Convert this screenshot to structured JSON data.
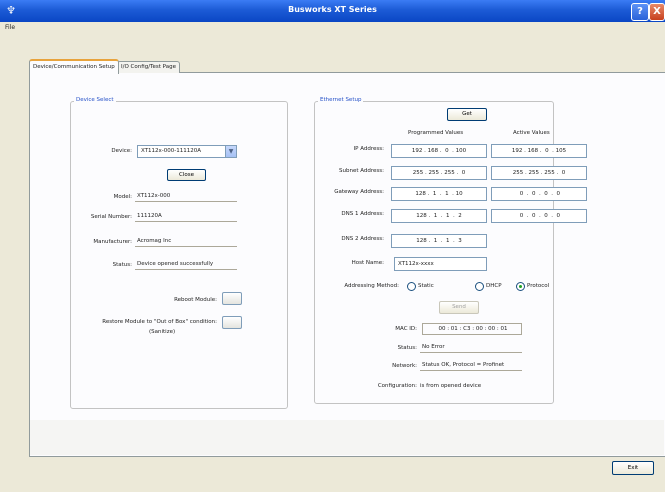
{
  "window": {
    "title": "Busworks XT Series",
    "help_glyph": "?",
    "close_glyph": "X",
    "icon_glyph": "♆"
  },
  "menu": {
    "file": "File"
  },
  "tabs": [
    {
      "label": "Device/Communication Setup",
      "selected": true
    },
    {
      "label": "I/O Config/Test Page",
      "selected": false
    }
  ],
  "device_select": {
    "legend": "Device Select",
    "device_label": "Device:",
    "device_value": "XT112x-000-111120A",
    "close_button": "Close",
    "model_label": "Model:",
    "model_value": "XT112x-000",
    "serial_label": "Serial Number:",
    "serial_value": "111120A",
    "manufacturer_label": "Manufacturer:",
    "manufacturer_value": "Acromag Inc",
    "status_label": "Status:",
    "status_value": "Device opened successfully",
    "reboot_label": "Reboot Module:",
    "restore_label": "Restore Module to \"Out of Box\" condition:",
    "restore_sub": "(Sanitize)"
  },
  "ethernet": {
    "legend": "Ethernet Setup",
    "get_button": "Get",
    "programmed_header": "Programmed Values",
    "active_header": "Active Values",
    "ip_label": "IP Address:",
    "ip_programmed": "192 . 168 .  0  . 100",
    "ip_active": "192 . 168 .  0  . 105",
    "subnet_label": "Subnet Address:",
    "subnet_programmed": "255 . 255 . 255 .  0",
    "subnet_active": "255 . 255 . 255 .  0",
    "gateway_label": "Gateway Address:",
    "gateway_programmed": "128 .  1  .  1  . 10",
    "gateway_active": " 0  .  0  .  0  .  0",
    "dns1_label": "DNS 1 Address:",
    "dns1_programmed": "128 .  1  .  1  .  2",
    "dns1_active": " 0  .  0  .  0  .  0",
    "dns2_label": "DNS 2 Address:",
    "dns2_programmed": "128 .  1  .  1  .  3",
    "host_label": "Host Name:",
    "host_value": "XT112x-xxxx",
    "addressing_label": "Addressing Method:",
    "method_static": "Static",
    "method_dhcp": "DHCP",
    "method_protocol": "Protocol",
    "selected_method": "Protocol",
    "send_button": "Send",
    "mac_label": "MAC ID:",
    "mac_value": "00 : 01 : C3 : 00 : 00 : 01",
    "status_label": "Status:",
    "status_value": "No Error",
    "network_label": "Network:",
    "network_value": "Status OK, Protocol = Profinet",
    "config_label": "Configuration:",
    "config_value": "is from opened device"
  },
  "footer": {
    "exit_button": "Exit"
  }
}
